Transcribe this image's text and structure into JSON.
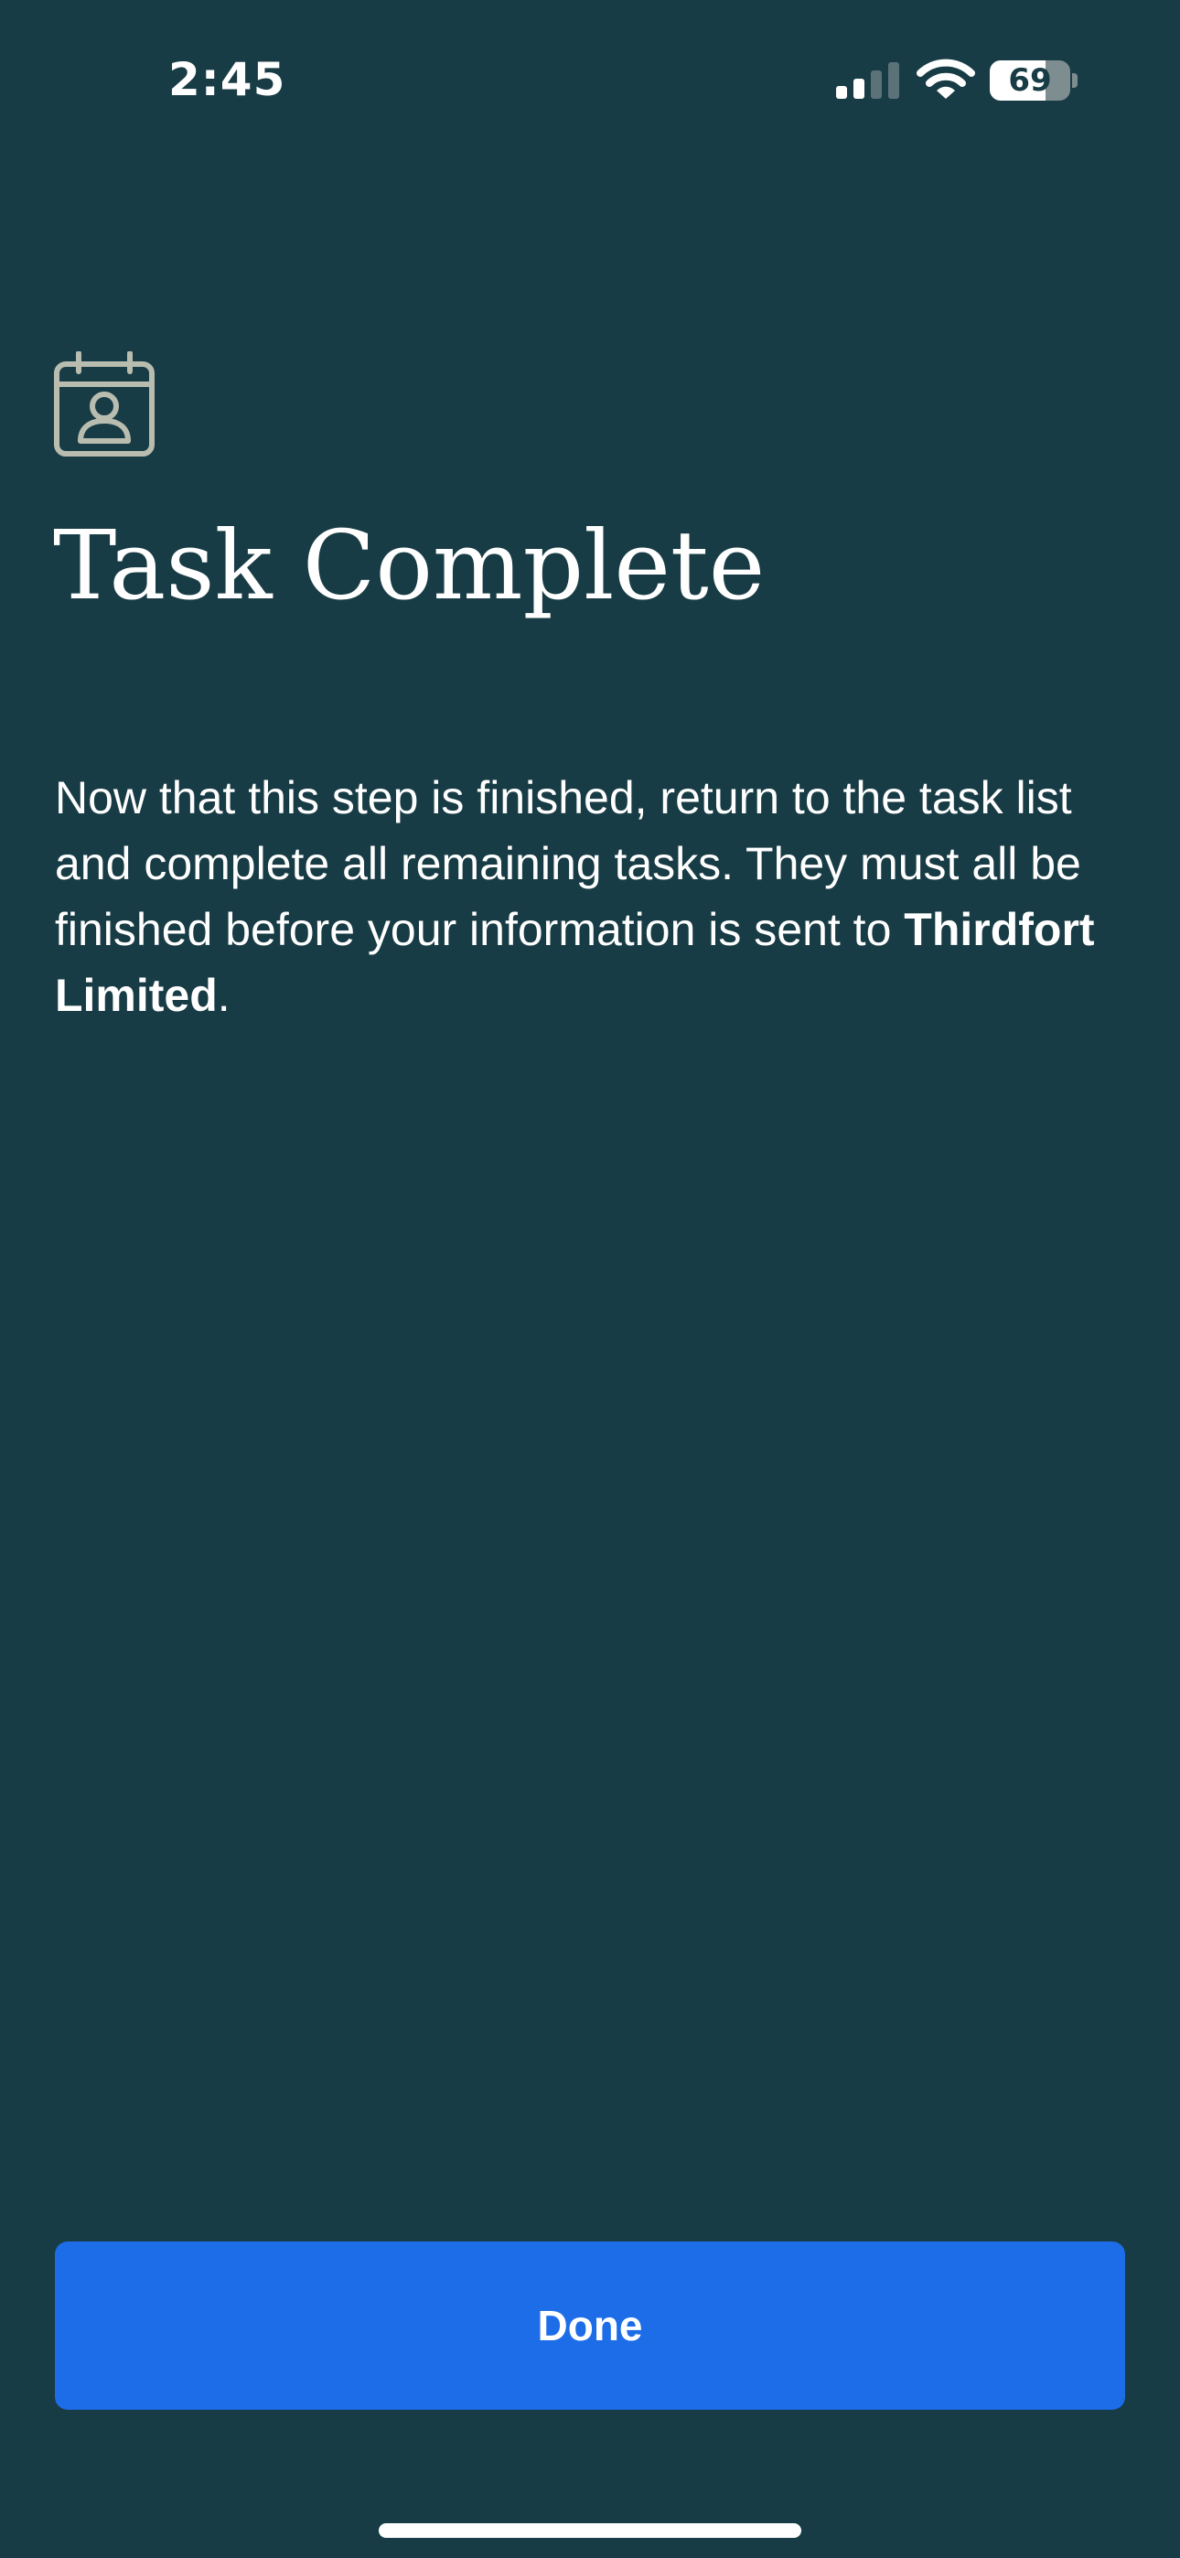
{
  "status_bar": {
    "time": "2:45",
    "battery_level": "69",
    "battery_fraction": 0.69,
    "signal_bars_active": 2,
    "signal_bars_total": 4,
    "icons": [
      "signal-icon",
      "wifi-icon",
      "battery-icon"
    ]
  },
  "header": {
    "icon": "calendar-person-icon",
    "title": "Task Complete"
  },
  "body": {
    "text_before": "Now that this step is finished, return to the task list and complete all remaining tasks. They must all be finished before your information is sent to ",
    "company_name": "Thirdfort Limited",
    "text_after": "."
  },
  "actions": {
    "done_label": "Done"
  },
  "colors": {
    "background": "#183c45",
    "button": "#1d6ce8",
    "text": "#ffffff",
    "icon_stroke": "#b9bdb0"
  }
}
